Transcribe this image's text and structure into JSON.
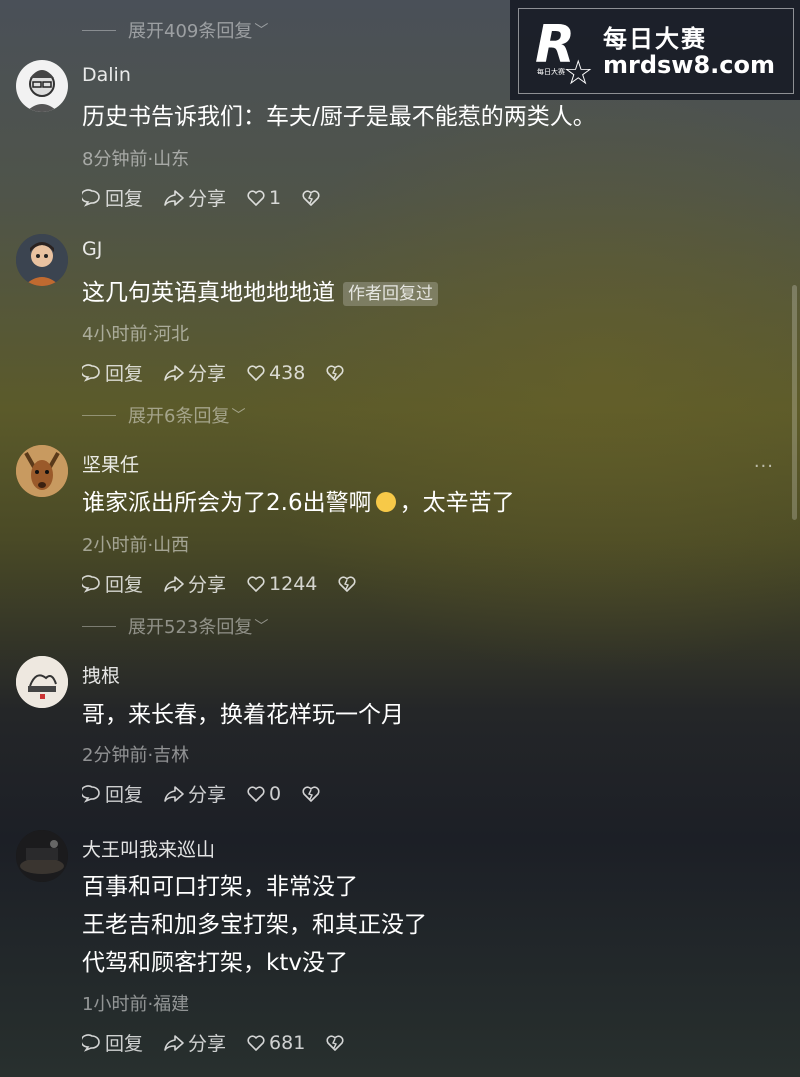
{
  "watermark": {
    "logo_letter": "R",
    "logo_small": "每日大赛",
    "title": "每日大赛",
    "site": "mrdsw8.com"
  },
  "folds": [
    "展开409条回复",
    "展开6条回复",
    "展开523条回复"
  ],
  "actions": {
    "reply": "回复",
    "share": "分享"
  },
  "comments": [
    {
      "name": "Dalin",
      "lines": [
        "历史书告诉我们：车夫/厨子是最不能惹的两类人。"
      ],
      "meta": "8分钟前·山东",
      "likes": "1"
    },
    {
      "name": "GJ",
      "lines": [
        "这几句英语真地地地地道"
      ],
      "tag": "作者回复过",
      "meta": "4小时前·河北",
      "likes": "438"
    },
    {
      "name": "坚果任",
      "line_before_emoji": "谁家派出所会为了2.6出警啊",
      "line_after_emoji": "，太辛苦了",
      "meta": "2小时前·山西",
      "likes": "1244",
      "more": "···"
    },
    {
      "name": "拽根",
      "lines": [
        "哥，来长春，换着花样玩一个月"
      ],
      "meta": "2分钟前·吉林",
      "likes": "0"
    },
    {
      "name": "大王叫我来巡山",
      "lines": [
        "百事和可口打架，非常没了",
        "王老吉和加多宝打架，和其正没了",
        "代驾和顾客打架，ktv没了"
      ],
      "meta": "1小时前·福建",
      "likes": "681"
    }
  ]
}
